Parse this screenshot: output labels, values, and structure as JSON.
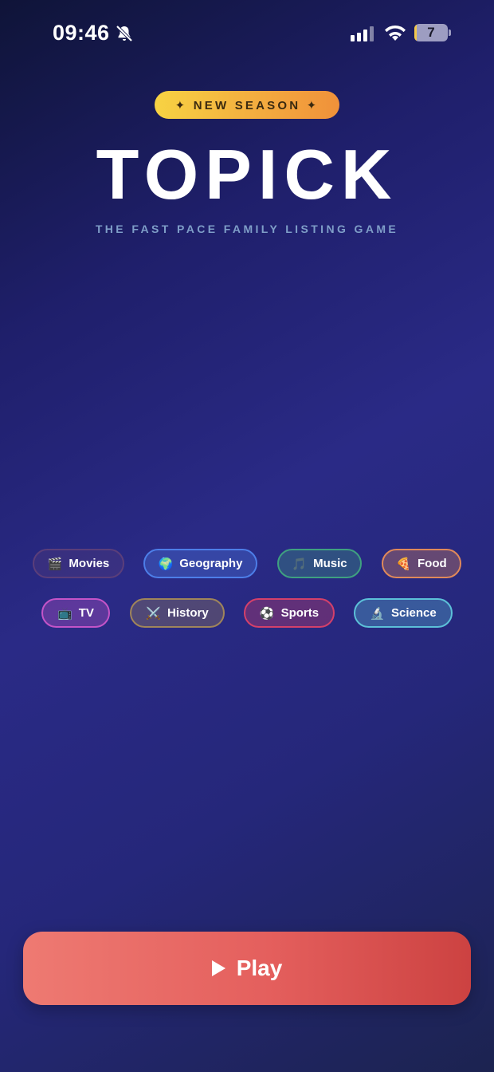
{
  "status_bar": {
    "time": "09:46",
    "battery": "7",
    "battery_level": 0.07
  },
  "header": {
    "badge": "✦  NEW SEASON  ✦",
    "title": "TOPICK",
    "subtitle": "THE FAST PACE FAMILY LISTING GAME"
  },
  "categories": [
    {
      "emoji": "🎬",
      "label": "Movies",
      "color": "#5b3e7a"
    },
    {
      "emoji": "🌍",
      "label": "Geography",
      "color": "#4d7ee8"
    },
    {
      "emoji": "🎵",
      "label": "Music",
      "color": "#3fa080"
    },
    {
      "emoji": "🍕",
      "label": "Food",
      "color": "#e0895a"
    },
    {
      "emoji": "📺",
      "label": "TV",
      "color": "#c454c8"
    },
    {
      "emoji": "⚔️",
      "label": "History",
      "color": "#a0855a"
    },
    {
      "emoji": "⚽",
      "label": "Sports",
      "color": "#d4406a"
    },
    {
      "emoji": "🔬",
      "label": "Science",
      "color": "#5cc0d8"
    }
  ],
  "play_button": {
    "label": "Play",
    "icon": "play-icon"
  }
}
